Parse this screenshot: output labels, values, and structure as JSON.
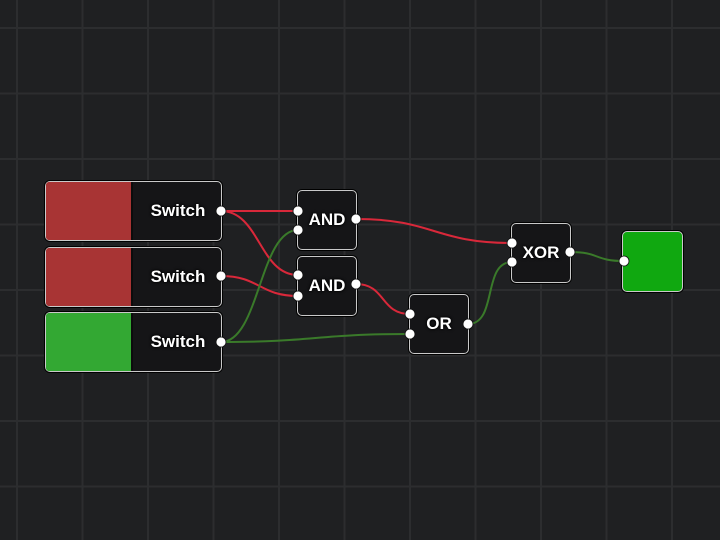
{
  "colors": {
    "signal_on": "#3a7a2a",
    "signal_off": "#d9283a",
    "switch_on": "#33a833",
    "switch_off": "#a83434",
    "led_on": "#10a810",
    "port": "#ffffff"
  },
  "nodes": [
    {
      "id": "sw1",
      "type": "switch",
      "label": "Switch",
      "state": false
    },
    {
      "id": "sw2",
      "type": "switch",
      "label": "Switch",
      "state": false
    },
    {
      "id": "sw3",
      "type": "switch",
      "label": "Switch",
      "state": true
    },
    {
      "id": "and1",
      "type": "gate",
      "label": "AND"
    },
    {
      "id": "and2",
      "type": "gate",
      "label": "AND"
    },
    {
      "id": "or1",
      "type": "gate",
      "label": "OR"
    },
    {
      "id": "xor1",
      "type": "gate",
      "label": "XOR"
    },
    {
      "id": "led1",
      "type": "led",
      "state": true
    }
  ],
  "wires": [
    {
      "from": "sw1.out",
      "to": "and1.in1",
      "state": false
    },
    {
      "from": "sw1.out",
      "to": "and2.in1",
      "state": false
    },
    {
      "from": "sw2.out",
      "to": "and2.in2",
      "state": false
    },
    {
      "from": "sw3.out",
      "to": "and1.in2",
      "state": true
    },
    {
      "from": "sw3.out",
      "to": "or1.in2",
      "state": true
    },
    {
      "from": "and1.out",
      "to": "xor1.in1",
      "state": false
    },
    {
      "from": "and2.out",
      "to": "or1.in1",
      "state": false
    },
    {
      "from": "or1.out",
      "to": "xor1.in2",
      "state": true
    },
    {
      "from": "xor1.out",
      "to": "led1.in1",
      "state": true
    }
  ]
}
